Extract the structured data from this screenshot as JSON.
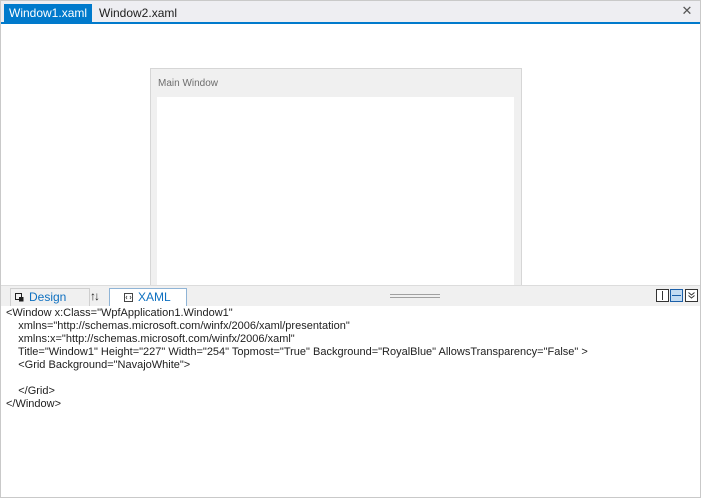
{
  "tabs": [
    {
      "label": "Window1.xaml",
      "active": true
    },
    {
      "label": "Window2.xaml",
      "active": false
    }
  ],
  "close_symbol": "✕",
  "designer": {
    "window_title": "Main Window"
  },
  "pane_tabs": {
    "design_label": "Design",
    "xaml_label": "XAML",
    "swap_symbol": "↑↓"
  },
  "code_lines": [
    "<Window x:Class=\"WpfApplication1.Window1\"",
    "    xmlns=\"http://schemas.microsoft.com/winfx/2006/xaml/presentation\"",
    "    xmlns:x=\"http://schemas.microsoft.com/winfx/2006/xaml\"",
    "    Title=\"Window1\" Height=\"227\" Width=\"254\" Topmost=\"True\" Background=\"RoyalBlue\" AllowsTransparency=\"False\" >",
    "    <Grid Background=\"NavajoWhite\">",
    "",
    "    </Grid>",
    "</Window>"
  ],
  "colors": {
    "accent": "#007acc",
    "tab_text": "#0e70c0"
  }
}
